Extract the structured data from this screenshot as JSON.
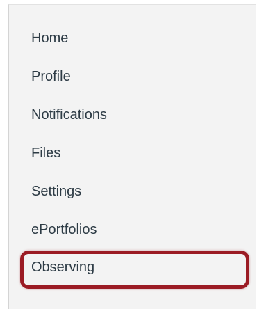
{
  "nav": {
    "items": [
      {
        "label": "Home"
      },
      {
        "label": "Profile"
      },
      {
        "label": "Notifications"
      },
      {
        "label": "Files"
      },
      {
        "label": "Settings"
      },
      {
        "label": "ePortfolios"
      },
      {
        "label": "Observing"
      }
    ]
  },
  "colors": {
    "panel_background": "#f3f3f3",
    "link_text": "#2d3b45",
    "highlight_border": "#9b1b24"
  }
}
